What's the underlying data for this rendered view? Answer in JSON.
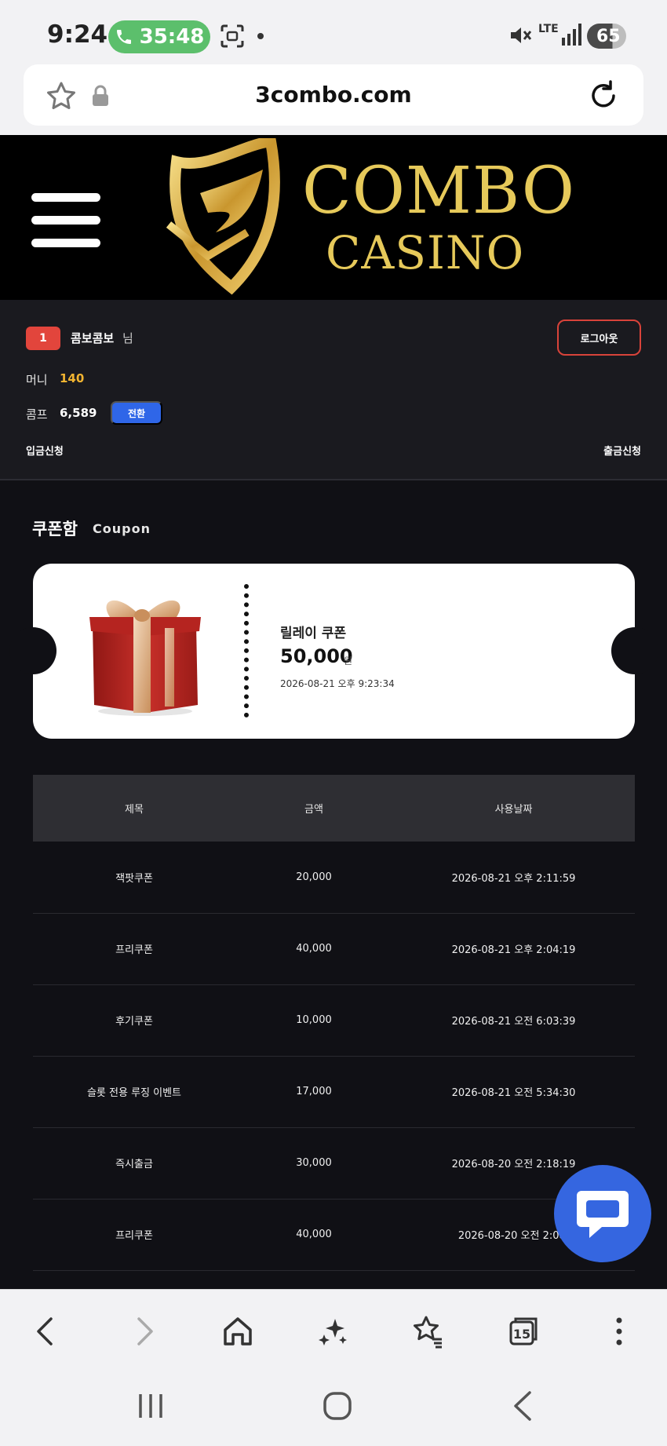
{
  "status_bar": {
    "time": "9:24",
    "call_timer": "35:48",
    "network": "LTE",
    "battery": "65"
  },
  "browser": {
    "url": "3combo.com",
    "tab_count": "15"
  },
  "site": {
    "logo_line1": "COMBO",
    "logo_line2": "CASINO"
  },
  "user": {
    "level": "1",
    "name": "콤보콤보",
    "honorific": "님",
    "logout_label": "로그아웃",
    "money_label": "머니",
    "money_value": "140",
    "comp_label": "콤프",
    "comp_value": "6,589",
    "convert_label": "전환",
    "deposit_label": "입금신청",
    "withdraw_label": "출금신청"
  },
  "section": {
    "title": "쿠폰함",
    "subtitle": "Coupon"
  },
  "coupon": {
    "name": "릴레이 쿠폰",
    "amount": "50,000",
    "unit": "원",
    "date": "2026-08-21 오후 9:23:34"
  },
  "table": {
    "headers": [
      "제목",
      "금액",
      "사용날짜"
    ],
    "rows": [
      {
        "title": "잭팟쿠폰",
        "amount": "20,000",
        "date": "2026-08-21 오후 2:11:59"
      },
      {
        "title": "프리쿠폰",
        "amount": "40,000",
        "date": "2026-08-21 오후 2:04:19"
      },
      {
        "title": "후기쿠폰",
        "amount": "10,000",
        "date": "2026-08-21 오전 6:03:39"
      },
      {
        "title": "슬롯 전용 루징 이벤트",
        "amount": "17,000",
        "date": "2026-08-21 오전 5:34:30"
      },
      {
        "title": "즉시출금",
        "amount": "30,000",
        "date": "2026-08-20 오전 2:18:19"
      },
      {
        "title": "프리쿠폰",
        "amount": "40,000",
        "date": "2026-08-20 오전 2:08:"
      }
    ]
  },
  "colors": {
    "accent_red": "#e2453c",
    "accent_blue": "#2f66e8",
    "money_gold": "#f2b431",
    "logo_gold": "#e6c95a"
  },
  "icons": {
    "call": "phone-icon",
    "chat": "chat-bubble-icon",
    "gift": "gift-box-icon"
  }
}
